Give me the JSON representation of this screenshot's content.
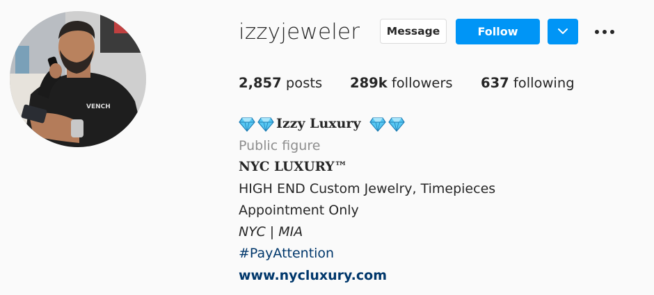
{
  "profile": {
    "username": "izzyjeweler",
    "message_label": "Message",
    "follow_label": "Follow"
  },
  "stats": {
    "posts_count": "2,857",
    "posts_label": "posts",
    "followers_count": "289k",
    "followers_label": "followers",
    "following_count": "637",
    "following_label": "following"
  },
  "bio": {
    "full_name": "Izzy Luxury",
    "category": "Public figure",
    "line1": "NYC LUXURY™",
    "line2": "HIGH END Custom Jewelry, Timepieces",
    "line3": "Appointment Only",
    "line4": "NYC | MIA",
    "hashtag": "#PayAttention",
    "website": "www.nycluxury.com"
  },
  "icons": {
    "dropdown": "chevron-down-icon",
    "more": "more-options-icon",
    "gem": "gem-stone-icon"
  },
  "colors": {
    "accent": "#0095f6",
    "link": "#00376b",
    "muted": "#8e8e8e",
    "text": "#262626",
    "background": "#fafafa"
  }
}
